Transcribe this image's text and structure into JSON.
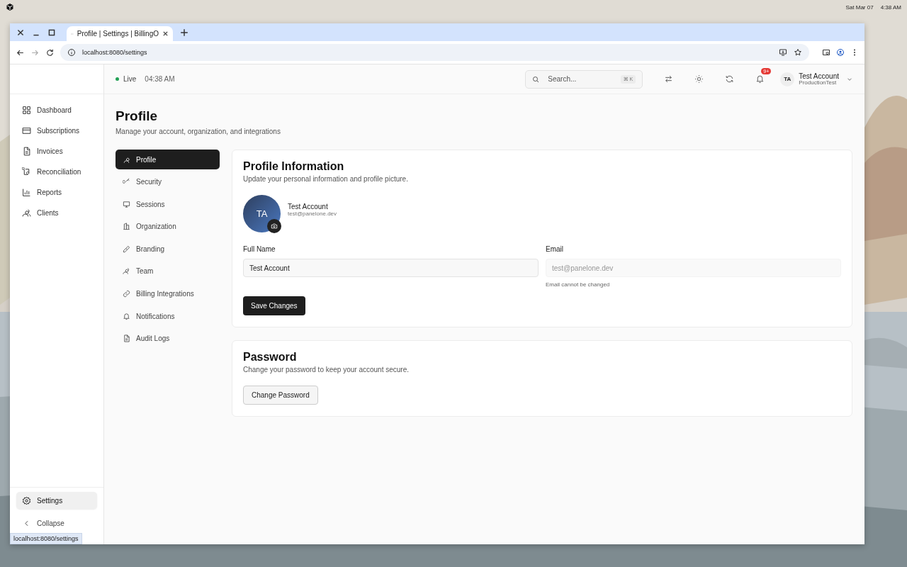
{
  "desktop": {
    "date": "Sat Mar 07",
    "time": "4:38 AM"
  },
  "browser": {
    "tab_title": "Profile | Settings | BillingO",
    "url": "localhost:8080/settings",
    "status_url": "localhost:8080/settings"
  },
  "sidebar": {
    "items": [
      {
        "label": "Dashboard",
        "selected": false
      },
      {
        "label": "Subscriptions",
        "selected": false
      },
      {
        "label": "Invoices",
        "selected": false
      },
      {
        "label": "Reconciliation",
        "selected": false
      },
      {
        "label": "Reports",
        "selected": false
      },
      {
        "label": "Clients",
        "selected": false
      }
    ],
    "settings": {
      "label": "Settings",
      "selected": true
    },
    "collapse": "Collapse"
  },
  "header": {
    "status": "Live",
    "time": "04:38 AM",
    "search": {
      "placeholder": "Search...",
      "shortcut": "⌘ K"
    },
    "notification_badge": "9+",
    "user": {
      "initials": "TA",
      "name": "Test Account",
      "org": "ProductionTest"
    }
  },
  "page": {
    "title": "Profile",
    "subtitle": "Manage your account, organization, and integrations"
  },
  "settings_nav": [
    {
      "label": "Profile",
      "selected": true
    },
    {
      "label": "Security",
      "selected": false
    },
    {
      "label": "Sessions",
      "selected": false
    },
    {
      "label": "Organization",
      "selected": false
    },
    {
      "label": "Branding",
      "selected": false
    },
    {
      "label": "Team",
      "selected": false
    },
    {
      "label": "Billing Integrations",
      "selected": false
    },
    {
      "label": "Notifications",
      "selected": false
    },
    {
      "label": "Audit Logs",
      "selected": false
    }
  ],
  "profile_card": {
    "title": "Profile Information",
    "subtitle": "Update your personal information and profile picture.",
    "avatar_initials": "TA",
    "name": "Test Account",
    "email": "test@panelone.dev",
    "fields": [
      {
        "label": "Full Name",
        "value": "Test Account",
        "disabled": false
      },
      {
        "label": "Email",
        "value": "test@panelone.dev",
        "disabled": true,
        "hint": "Email cannot be changed"
      }
    ],
    "button": "Save Changes"
  },
  "password_card": {
    "title": "Password",
    "subtitle": "Change your password to keep your account secure.",
    "button": "Change Password"
  }
}
